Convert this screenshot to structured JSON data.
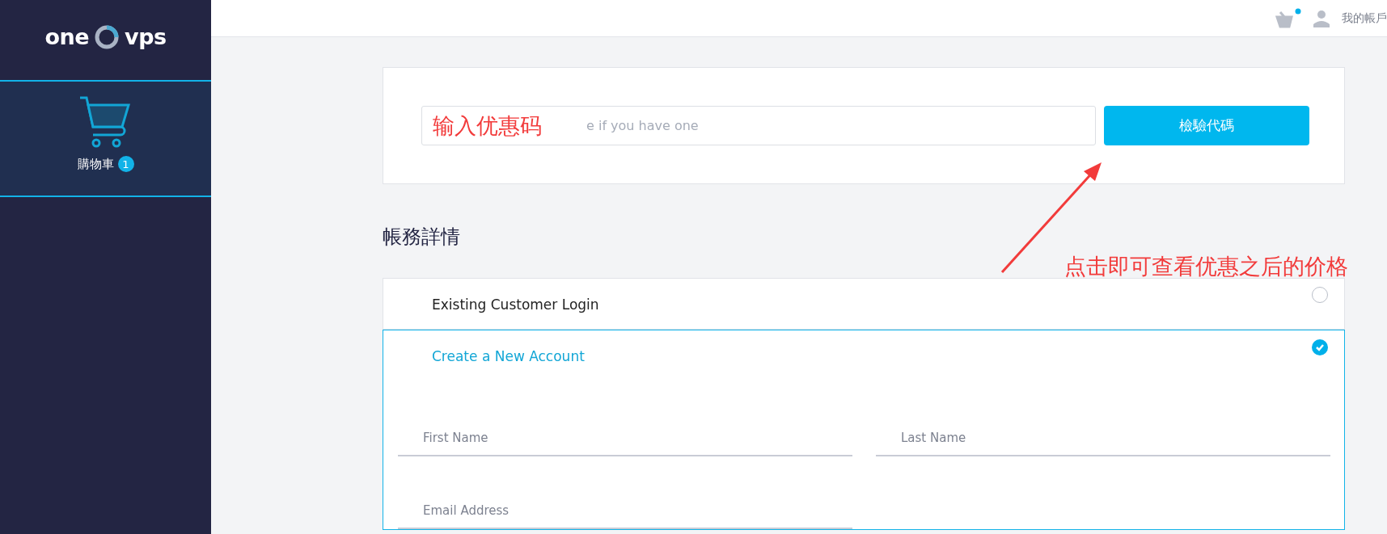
{
  "sidebar": {
    "logo": {
      "left": "one",
      "right": "vps"
    },
    "items": [
      {
        "label": "購物車",
        "badge": "1",
        "selected": true
      }
    ]
  },
  "top_bar": {
    "account_label": "我的帳戶",
    "cart_notification": true
  },
  "promo": {
    "placeholder": "e if you have one",
    "button": "檢驗代碼"
  },
  "billing": {
    "heading": "帳務詳情",
    "options": [
      {
        "label": "Existing Customer Login",
        "selected": false
      },
      {
        "label": "Create a New Account",
        "selected": true
      }
    ],
    "fields": [
      {
        "placeholder": "First Name"
      },
      {
        "placeholder": "Last Name"
      },
      {
        "placeholder": "Email Address"
      }
    ]
  },
  "annotations": [
    {
      "text": "输入优惠码"
    },
    {
      "text": "点击即可查看优惠之后的价格"
    }
  ]
}
